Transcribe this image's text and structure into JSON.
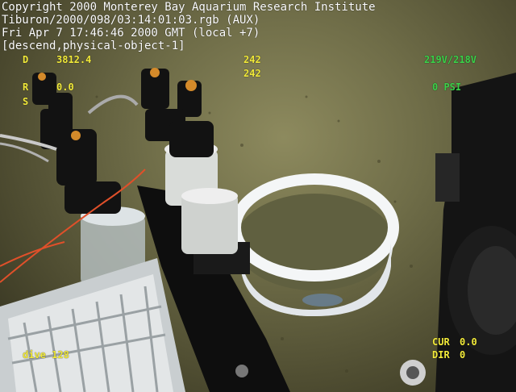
{
  "overlay": {
    "line1": "Copyright 2000 Monterey Bay Aquarium Research Institute",
    "line2": "Tiburon/2000/098/03:14:01:03.rgb (AUX)",
    "line3": "Fri Apr  7 17:46:46 2000 GMT (local +7)",
    "line4": "[descend,physical-object-1]"
  },
  "telemetry": {
    "depth_label": "D",
    "depth_value": "3812.4",
    "heading1": "242",
    "heading2": "242",
    "r_label": "R",
    "r_value": "0.0",
    "s_label": "S",
    "voltage": "219V/218V",
    "psi": "0   PSI",
    "dive": "dive 128",
    "cur_label": "CUR",
    "cur_value": "0.0",
    "dir_label": "DIR",
    "dir_value": "0"
  },
  "colors": {
    "overlay_text": "#ffffff",
    "yellow_text": "#f2ea3a",
    "green_text": "#3cd24a"
  }
}
